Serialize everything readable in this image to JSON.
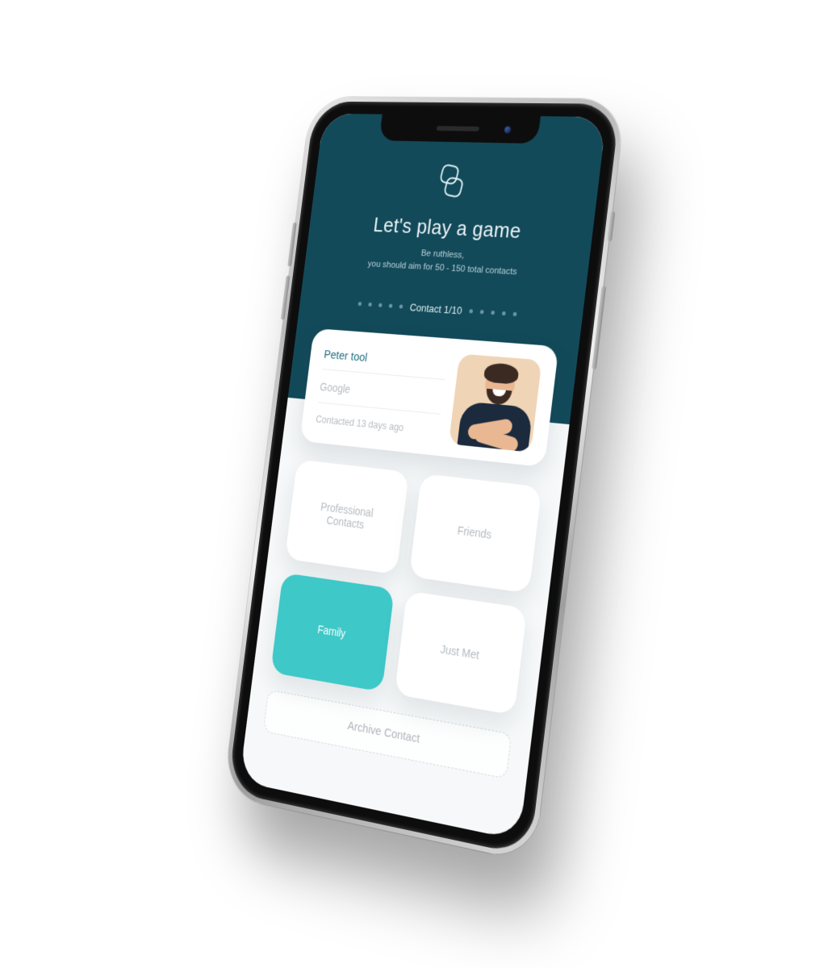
{
  "header": {
    "title": "Let's play a game",
    "subtitle_line1": "Be ruthless,",
    "subtitle_line2": "you should aim for 50 - 150 total contacts",
    "pager_label": "Contact 1/10"
  },
  "contact": {
    "name": "Peter tool",
    "company": "Google",
    "last_contacted": "Contacted 13 days ago"
  },
  "categories": [
    {
      "label": "Professional Contacts",
      "active": false
    },
    {
      "label": "Friends",
      "active": false
    },
    {
      "label": "Family",
      "active": true
    },
    {
      "label": "Just Met",
      "active": false
    }
  ],
  "archive_label": "Archive Contact",
  "colors": {
    "header_bg": "#134a5a",
    "accent": "#3ec8c8",
    "name": "#1e6e7f"
  }
}
